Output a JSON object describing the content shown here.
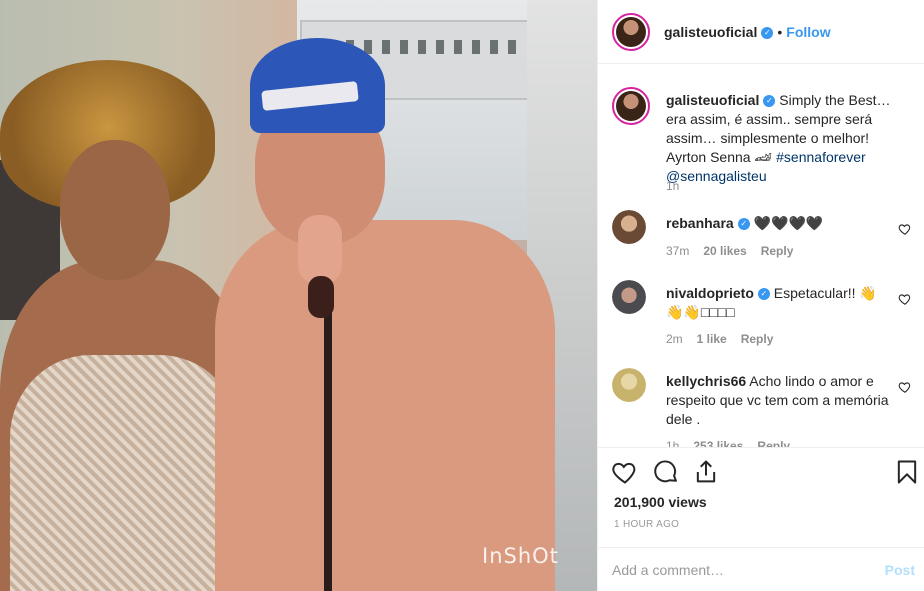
{
  "media": {
    "watermark": "InShOt"
  },
  "header": {
    "username": "galisteuoficial",
    "separator": "•",
    "follow_label": "Follow"
  },
  "caption": {
    "username": "galisteuoficial",
    "text": "Simply the Best… era assim, é assim.. sempre será assim… simplesmente o melhor! Ayrton Senna 🏎 ",
    "hashtag": "#sennaforever",
    "mention": "@sennagalisteu",
    "time": "1h"
  },
  "comments": [
    {
      "username": "rebanhara",
      "verified": true,
      "text": "🖤🖤🖤🖤",
      "time": "37m",
      "likes": "20 likes",
      "reply_label": "Reply"
    },
    {
      "username": "nivaldoprieto",
      "verified": true,
      "text": "Espetacular!! 👋👋👋□□□□",
      "time": "2m",
      "likes": "1 like",
      "reply_label": "Reply"
    },
    {
      "username": "kellychris66",
      "verified": false,
      "text": "Acho lindo o amor e respeito que vc tem com a memória dele .",
      "time": "1h",
      "likes": "253 likes",
      "reply_label": "Reply"
    }
  ],
  "actions": {
    "like_icon": "heart-icon",
    "comment_icon": "comment-icon",
    "share_icon": "share-icon",
    "save_icon": "bookmark-icon",
    "views": "201,900 views",
    "time_ago": "1 HOUR AGO"
  },
  "add_comment": {
    "placeholder": "Add a comment…",
    "post_label": "Post"
  },
  "colors": {
    "accent": "#3897f0",
    "post_disabled": "#b2dffc",
    "link": "#003569",
    "story_ring": "#d6249f"
  }
}
